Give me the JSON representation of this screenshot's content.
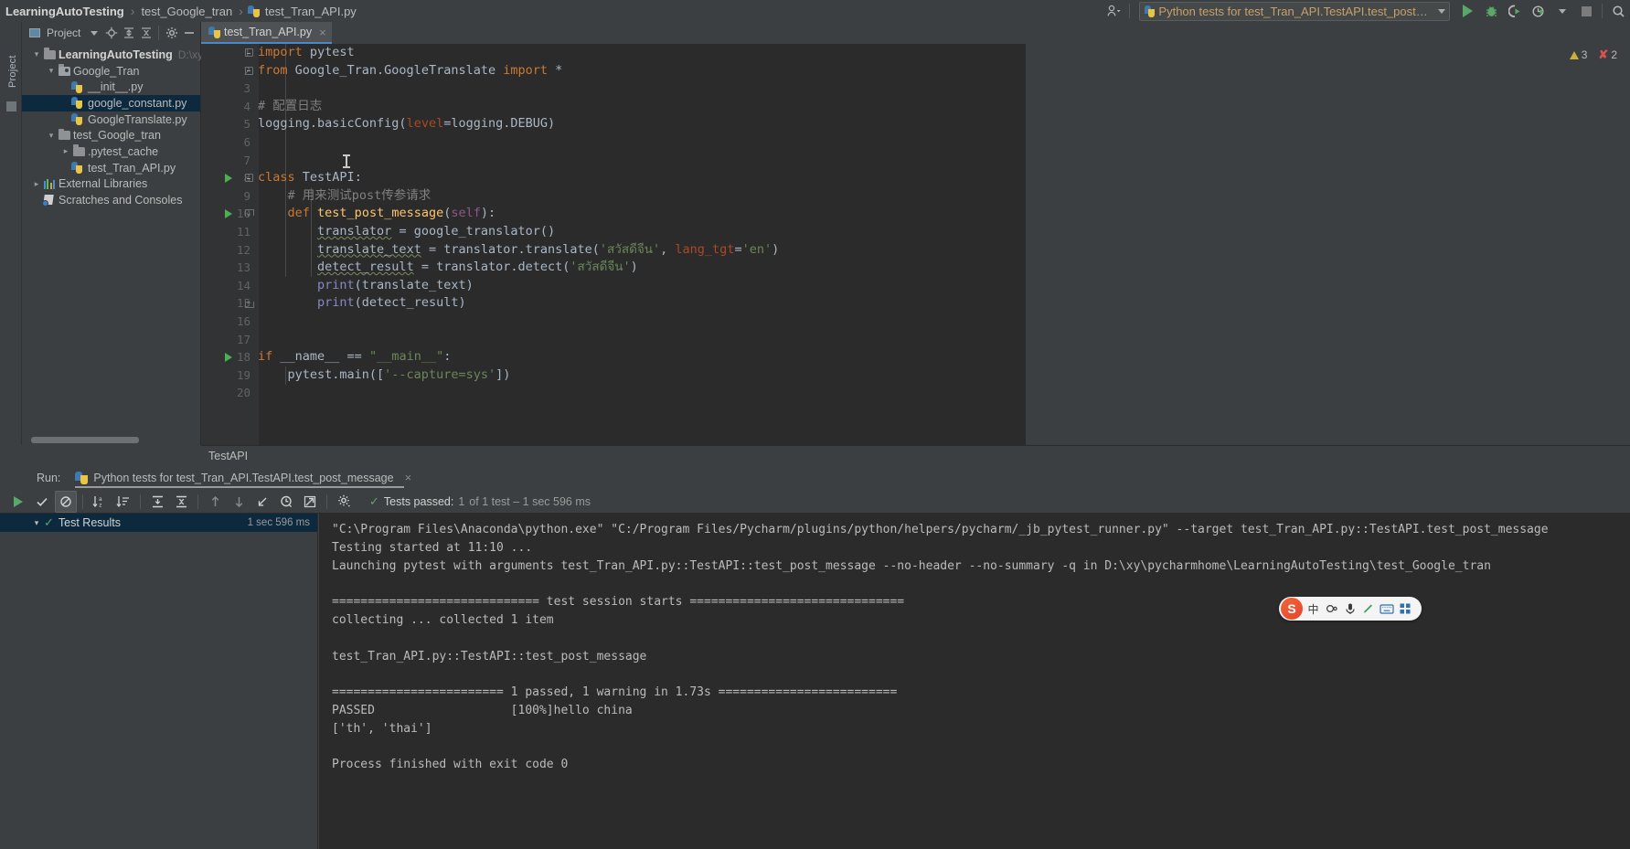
{
  "window": {
    "breadcrumb": [
      {
        "label": "LearningAutoTesting",
        "bold": true,
        "icon": null
      },
      {
        "label": "test_Google_tran",
        "bold": false,
        "icon": null
      },
      {
        "label": "test_Tran_API.py",
        "bold": false,
        "icon": "python-file-icon"
      }
    ],
    "separator": "›"
  },
  "toolbar": {
    "profile_icon": "user-icon",
    "run_config": {
      "label": "Python tests for test_Tran_API.TestAPI.test_post_message",
      "icon": "pytest-config-icon"
    },
    "buttons": [
      {
        "name": "run-button",
        "icon": "run-triangle-icon",
        "title": "Run"
      },
      {
        "name": "debug-button",
        "icon": "debug-bug-icon",
        "title": "Debug"
      },
      {
        "name": "run-with-coverage-button",
        "icon": "coverage-icon",
        "title": "Run with Coverage"
      },
      {
        "name": "profile-button",
        "icon": "profiler-clock-icon",
        "title": "Profile"
      },
      {
        "name": "stop-button",
        "icon": "stop-square-icon",
        "title": "Stop"
      },
      {
        "name": "search-everywhere-button",
        "icon": "search-icon",
        "title": "Search Everywhere"
      }
    ]
  },
  "project_panel": {
    "title": "Project",
    "header_icons": [
      "project-view-icon",
      "chevron-down-icon",
      "locate-icon",
      "expand-all-icon",
      "collapse-all-icon",
      "gear-icon",
      "hide-icon"
    ],
    "stripe_label": "Project",
    "tree": [
      {
        "label": "LearningAutoTesting",
        "sub": "D:\\xy\\pych",
        "icon": "folder-icon",
        "depth": 0,
        "arrow": "open",
        "bold": true,
        "selected": false
      },
      {
        "label": "Google_Tran",
        "sub": "",
        "icon": "source-folder-icon",
        "depth": 1,
        "arrow": "open",
        "bold": false,
        "selected": false
      },
      {
        "label": "__init__.py",
        "sub": "",
        "icon": "python-file-icon",
        "depth": 2,
        "arrow": "none",
        "bold": false,
        "selected": false
      },
      {
        "label": "google_constant.py",
        "sub": "",
        "icon": "python-file-icon",
        "depth": 2,
        "arrow": "none",
        "bold": false,
        "selected": true
      },
      {
        "label": "GoogleTranslate.py",
        "sub": "",
        "icon": "python-file-icon",
        "depth": 2,
        "arrow": "none",
        "bold": false,
        "selected": false
      },
      {
        "label": "test_Google_tran",
        "sub": "",
        "icon": "folder-icon",
        "depth": 1,
        "arrow": "open",
        "bold": false,
        "selected": false
      },
      {
        "label": ".pytest_cache",
        "sub": "",
        "icon": "folder-icon",
        "depth": 2,
        "arrow": "closed",
        "bold": false,
        "selected": false
      },
      {
        "label": "test_Tran_API.py",
        "sub": "",
        "icon": "python-file-icon",
        "depth": 2,
        "arrow": "none",
        "bold": false,
        "selected": false
      },
      {
        "label": "External Libraries",
        "sub": "",
        "icon": "libraries-icon",
        "depth": 0,
        "arrow": "closed",
        "bold": false,
        "selected": false
      },
      {
        "label": "Scratches and Consoles",
        "sub": "",
        "icon": "scratches-icon",
        "depth": 0,
        "arrow": "none",
        "bold": false,
        "selected": false
      }
    ]
  },
  "editor": {
    "tab": {
      "label": "test_Tran_API.py",
      "icon": "python-file-icon",
      "close": "×"
    },
    "inspections": {
      "warning_icon": "warning-triangle-icon",
      "warning_count": "3",
      "error_icon": "error-x-icon",
      "error_count": "2",
      "ok_icon": "check-icon"
    },
    "breadcrumb": "TestAPI",
    "lines": [
      {
        "n": "1",
        "runnable": false,
        "fold": "minus",
        "tokens": [
          {
            "t": "import",
            "c": "kw"
          },
          {
            "t": " pytest",
            "c": "id"
          }
        ]
      },
      {
        "n": "2",
        "runnable": false,
        "fold": "updn",
        "tokens": [
          {
            "t": "from",
            "c": "kw"
          },
          {
            "t": " Google_Tran.GoogleTranslate ",
            "c": "id"
          },
          {
            "t": "import",
            "c": "kw"
          },
          {
            "t": " *",
            "c": "id"
          }
        ]
      },
      {
        "n": "3",
        "runnable": false,
        "fold": "none",
        "tokens": []
      },
      {
        "n": "4",
        "runnable": false,
        "fold": "none",
        "tokens": [
          {
            "t": "# 配置日志",
            "c": "cmt"
          }
        ]
      },
      {
        "n": "5",
        "runnable": false,
        "fold": "none",
        "tokens": [
          {
            "t": "logging.basicConfig(",
            "c": "id"
          },
          {
            "t": "level",
            "c": "prm"
          },
          {
            "t": "=logging.DEBUG)",
            "c": "id"
          }
        ]
      },
      {
        "n": "6",
        "runnable": false,
        "fold": "none",
        "tokens": []
      },
      {
        "n": "7",
        "runnable": false,
        "fold": "none",
        "tokens": []
      },
      {
        "n": "8",
        "runnable": true,
        "fold": "minus",
        "tokens": [
          {
            "t": "class",
            "c": "kw"
          },
          {
            "t": " ",
            "c": "id"
          },
          {
            "t": "TestAPI",
            "c": "cls"
          },
          {
            "t": ":",
            "c": "id"
          }
        ]
      },
      {
        "n": "9",
        "runnable": false,
        "fold": "none",
        "tokens": [
          {
            "t": "    # 用来测试post传参请求",
            "c": "cmt"
          }
        ]
      },
      {
        "n": "10",
        "runnable": true,
        "fold": "dn",
        "tokens": [
          {
            "t": "    ",
            "c": "id"
          },
          {
            "t": "def",
            "c": "kw"
          },
          {
            "t": " ",
            "c": "id"
          },
          {
            "t": "test_post_message",
            "c": "fn"
          },
          {
            "t": "(",
            "c": "id"
          },
          {
            "t": "self",
            "c": "self"
          },
          {
            "t": "):",
            "c": "id"
          }
        ]
      },
      {
        "n": "11",
        "runnable": false,
        "fold": "none",
        "tokens": [
          {
            "t": "        ",
            "c": "id"
          },
          {
            "t": "translator",
            "c": "id wav"
          },
          {
            "t": " = google_translator()",
            "c": "id"
          }
        ]
      },
      {
        "n": "12",
        "runnable": false,
        "fold": "none",
        "tokens": [
          {
            "t": "        ",
            "c": "id"
          },
          {
            "t": "translate_text",
            "c": "id wav"
          },
          {
            "t": " = translator.translate(",
            "c": "id"
          },
          {
            "t": "'สวัสดีจีน'",
            "c": "str"
          },
          {
            "t": ", ",
            "c": "id"
          },
          {
            "t": "lang_tgt",
            "c": "prm"
          },
          {
            "t": "=",
            "c": "id"
          },
          {
            "t": "'en'",
            "c": "str"
          },
          {
            "t": ")",
            "c": "id"
          }
        ]
      },
      {
        "n": "13",
        "runnable": false,
        "fold": "none",
        "tokens": [
          {
            "t": "        ",
            "c": "id"
          },
          {
            "t": "detect_result",
            "c": "id wav"
          },
          {
            "t": " = translator.detect(",
            "c": "id"
          },
          {
            "t": "'สวัสดีจีน'",
            "c": "str"
          },
          {
            "t": ")",
            "c": "id"
          }
        ]
      },
      {
        "n": "14",
        "runnable": false,
        "fold": "none",
        "tokens": [
          {
            "t": "        ",
            "c": "id"
          },
          {
            "t": "print",
            "c": "bif"
          },
          {
            "t": "(translate_text)",
            "c": "id"
          }
        ]
      },
      {
        "n": "15",
        "runnable": false,
        "fold": "up",
        "tokens": [
          {
            "t": "        ",
            "c": "id"
          },
          {
            "t": "print",
            "c": "bif"
          },
          {
            "t": "(detect_result)",
            "c": "id"
          }
        ]
      },
      {
        "n": "16",
        "runnable": false,
        "fold": "none",
        "tokens": []
      },
      {
        "n": "17",
        "runnable": false,
        "fold": "none",
        "tokens": []
      },
      {
        "n": "18",
        "runnable": true,
        "fold": "none",
        "tokens": [
          {
            "t": "if",
            "c": "kw"
          },
          {
            "t": " __name__ == ",
            "c": "id"
          },
          {
            "t": "\"__main__\"",
            "c": "str"
          },
          {
            "t": ":",
            "c": "id"
          }
        ]
      },
      {
        "n": "19",
        "runnable": false,
        "fold": "none",
        "tokens": [
          {
            "t": "    pytest.main([",
            "c": "id"
          },
          {
            "t": "'--capture=sys'",
            "c": "str"
          },
          {
            "t": "])",
            "c": "id"
          }
        ]
      },
      {
        "n": "20",
        "runnable": false,
        "fold": "none",
        "tokens": []
      }
    ]
  },
  "run_panel": {
    "run_label": "Run:",
    "tab_label": "Python tests for test_Tran_API.TestAPI.test_post_message",
    "tab_close": "×",
    "toolbar_buttons": [
      {
        "name": "rerun-button",
        "icon": "run-triangle-icon"
      },
      {
        "name": "show-passed-button",
        "icon": "check-icon"
      },
      {
        "name": "show-ignored-button",
        "icon": "circle-slash-icon"
      },
      {
        "name": "sort-alphabetically-button",
        "icon": "sort-az-icon"
      },
      {
        "name": "sort-by-duration-button",
        "icon": "sort-duration-icon"
      },
      {
        "name": "expand-all-button",
        "icon": "expand-all-icon"
      },
      {
        "name": "collapse-all-button",
        "icon": "collapse-all-icon"
      },
      {
        "name": "previous-occurrence-button",
        "icon": "arrow-up-icon"
      },
      {
        "name": "next-occurrence-button",
        "icon": "arrow-down-icon"
      },
      {
        "name": "scroll-to-source-button",
        "icon": "jump-to-source-icon"
      },
      {
        "name": "test-history-button",
        "icon": "history-clock-icon"
      },
      {
        "name": "export-test-results-button",
        "icon": "export-icon"
      },
      {
        "name": "settings-button",
        "icon": "gear-icon"
      }
    ],
    "status": {
      "check_icon": "check-icon",
      "prefix": "Tests passed:",
      "count": "1",
      "suffix": "of 1 test – 1 sec 596 ms"
    },
    "tree": {
      "root_label": "Test Results",
      "root_time": "1 sec 596 ms",
      "root_icon": "check-icon",
      "arrow": "open"
    },
    "stripe_icons": [
      "history-icon",
      "pin-icon",
      "wrench-icon",
      "stop-icon",
      "layout-icon",
      "pin2-icon"
    ],
    "console_lines": [
      {
        "text": "\"C:\\Program Files\\Anaconda\\python.exe\" \"C:/Program Files/Pycharm/plugins/python/helpers/pycharm/_jb_pytest_runner.py\" --target test_Tran_API.py::TestAPI.test_post_message",
        "green": false
      },
      {
        "text": "Testing started at 11:10 ...",
        "green": false
      },
      {
        "text": "Launching pytest with arguments test_Tran_API.py::TestAPI::test_post_message --no-header --no-summary -q in D:\\xy\\pycharmhome\\LearningAutoTesting\\test_Google_tran",
        "green": false
      },
      {
        "text": "",
        "green": false
      },
      {
        "text": "============================= test session starts ==============================",
        "green": false
      },
      {
        "text": "collecting ... collected 1 item",
        "green": false
      },
      {
        "text": "",
        "green": false
      },
      {
        "text": "test_Tran_API.py::TestAPI::test_post_message",
        "green": false
      },
      {
        "text": "",
        "green": false
      },
      {
        "text": "======================== 1 passed, 1 warning in 1.73s =========================",
        "green": false
      },
      {
        "text": "PASSED                   [100%]hello china",
        "green": false
      },
      {
        "text": "['th', 'thai']",
        "green": false
      },
      {
        "text": "",
        "green": false
      },
      {
        "text": "Process finished with exit code 0",
        "green": false
      }
    ]
  },
  "ime": {
    "logo": "S",
    "buttons": [
      "中",
      "◑",
      "🎤",
      "✎",
      "⌨",
      "⊞"
    ]
  },
  "colors": {
    "accent_blue": "#4a88c7",
    "selection": "#0d293e",
    "editor_bg": "#2b2b2b",
    "chrome_bg": "#3c3f41",
    "green": "#59a869",
    "string": "#6a8759",
    "keyword": "#cc7832"
  }
}
